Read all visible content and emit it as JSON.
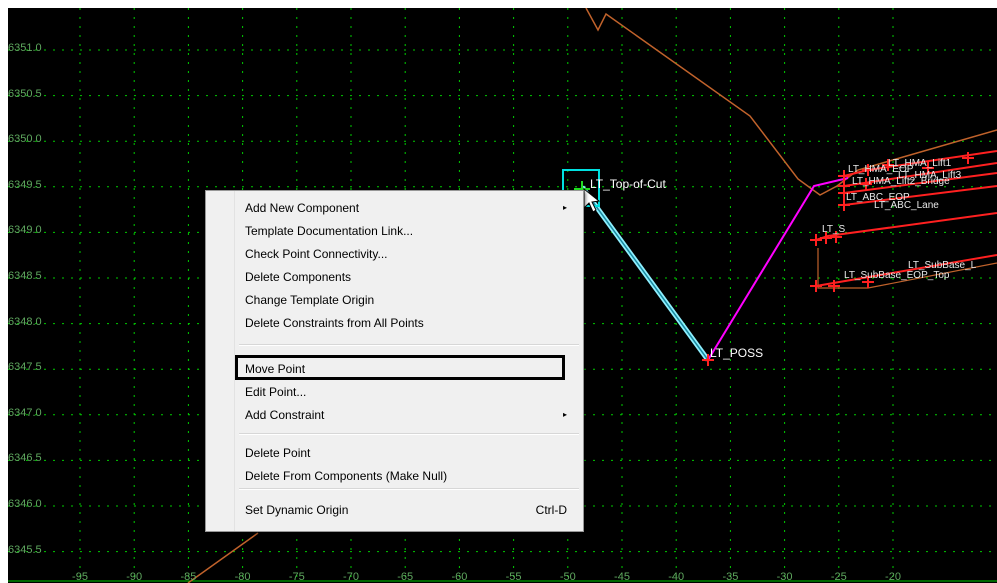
{
  "colors": {
    "background": "#000000",
    "grid": "#00cc00",
    "axis_labels": "#5fa85f",
    "ground_line": "#c0622b",
    "selected_segment": "#8ff0ff",
    "magenta_segment": "#ff00ff",
    "point_marker": "#ff2020",
    "active_point": "#22dd22",
    "menu_bg": "#f0f0f0"
  },
  "y_axis": [
    "6351.0",
    "6350.5",
    "6350.0",
    "6349.5",
    "6349.0",
    "6348.5",
    "6348.0",
    "6347.5",
    "6347.0",
    "6346.5",
    "6346.0",
    "6345.5"
  ],
  "x_axis": [
    "-95",
    "-90",
    "-85",
    "-80",
    "-75",
    "-70",
    "-65",
    "-60",
    "-55",
    "-50",
    "-45",
    "-40",
    "-35",
    "-30",
    "-25",
    "-20"
  ],
  "points": {
    "top_of_cut": "LT_Top-of-Cut",
    "poss": "LT_POSS"
  },
  "overlap_labels": [
    "LT_HMA_EOP",
    "LT_HMA_Lift1",
    "LT_HMA_Lift2_Bridge",
    "LT_HMA_Lift3",
    "LT_ABC_EOP",
    "LT_ABC_Lane",
    "LT_S",
    "LT_SubBase_EOP_Top",
    "LT_SubBase_L"
  ],
  "context_menu": {
    "items": [
      {
        "label": "Add New Component",
        "submenu": true
      },
      {
        "label": "Template Documentation Link..."
      },
      {
        "label": "Check Point Connectivity..."
      },
      {
        "label": "Delete Components"
      },
      {
        "label": "Change Template Origin"
      },
      {
        "label": "Delete Constraints from All Points"
      },
      {
        "label": "Move Point",
        "highlighted": true
      },
      {
        "label": "Edit Point..."
      },
      {
        "label": "Add Constraint",
        "submenu": true
      },
      {
        "label": "Delete Point"
      },
      {
        "label": "Delete From Components (Make Null)"
      },
      {
        "label": "Set Dynamic Origin",
        "shortcut": "Ctrl-D"
      }
    ],
    "submenu_arrow": "▸"
  }
}
